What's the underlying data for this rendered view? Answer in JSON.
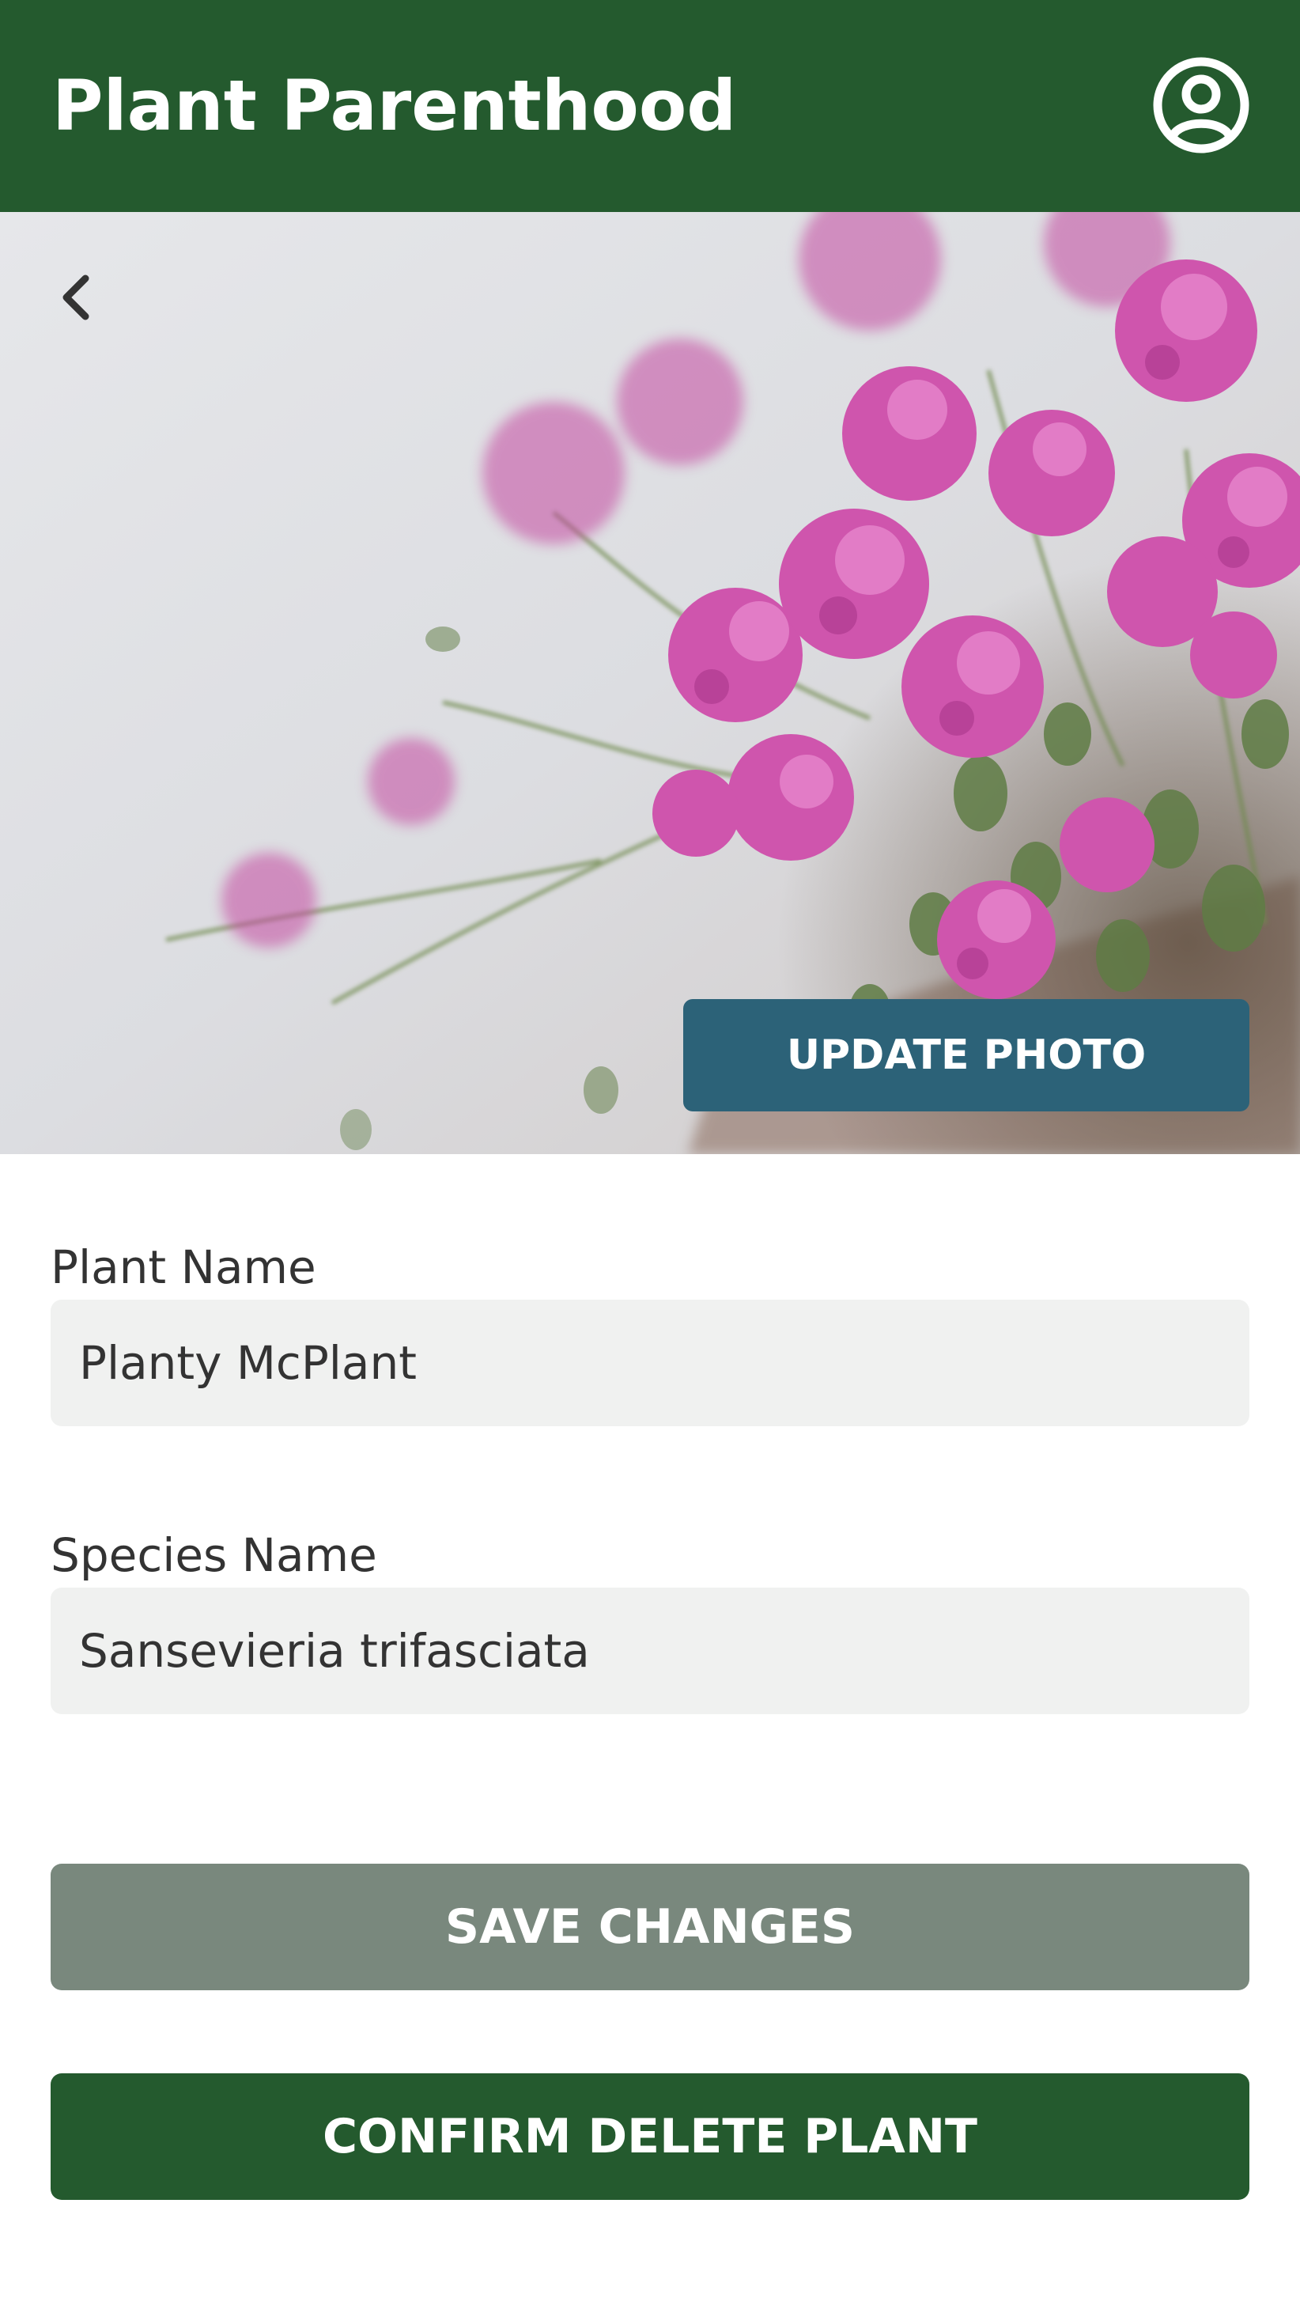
{
  "header": {
    "title": "Plant Parenthood",
    "profile_icon": "user-circle-icon",
    "background_color": "#245a2e"
  },
  "hero": {
    "back_icon": "chevron-left-icon",
    "update_photo_label": "UPDATE PHOTO",
    "update_photo_color": "#2c6278"
  },
  "form": {
    "plant_name": {
      "label": "Plant Name",
      "value": "Planty McPlant"
    },
    "species_name": {
      "label": "Species Name",
      "value": "Sansevieria trifasciata"
    }
  },
  "actions": {
    "save_label": "SAVE CHANGES",
    "save_color": "#79887d",
    "delete_label": "CONFIRM DELETE PLANT",
    "delete_color": "#245a2e"
  }
}
